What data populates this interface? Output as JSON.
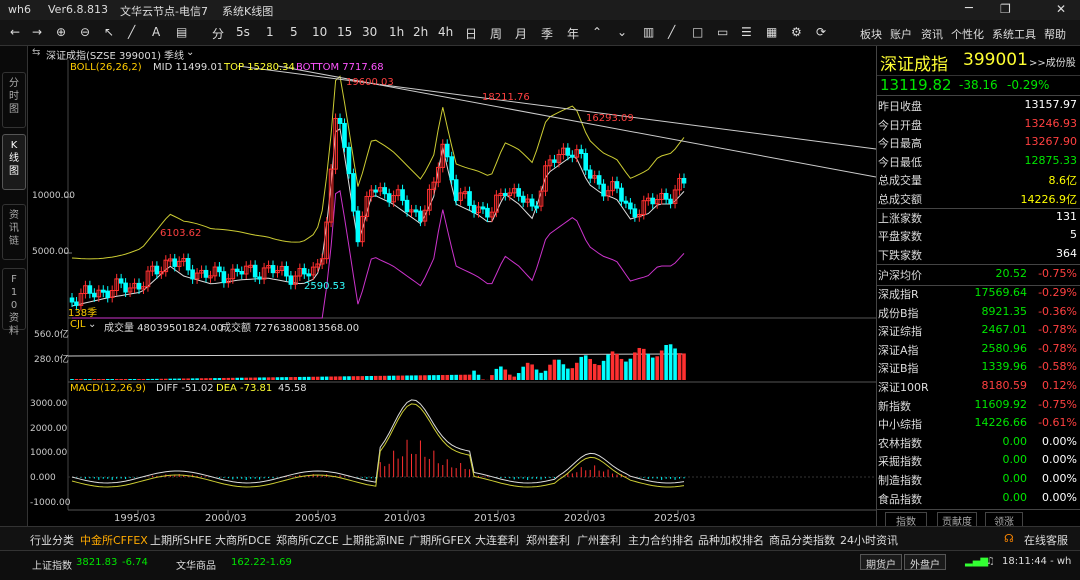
{
  "titlebar": {
    "app": "wh6",
    "version": "Ver6.8.813",
    "server": "文华云节点-电信7",
    "mode": "系统K线图"
  },
  "toolbar": {
    "periods": [
      "分",
      "5s",
      "1",
      "5",
      "10",
      "15",
      "30",
      "1h",
      "2h",
      "4h",
      "日",
      "周",
      "月",
      "季",
      "年"
    ],
    "right_menu": [
      "板块",
      "账户",
      "资讯",
      "个性化",
      "系统工具",
      "帮助"
    ]
  },
  "chart": {
    "instrument": "深证成指(SZSE 399001)",
    "period": "季线",
    "boll": {
      "name": "BOLL(26,26,2)",
      "mid": "MID 11499.01",
      "top": "TOP 15280.34",
      "bottom": "BOTTOM 7717.68"
    },
    "price_labels": [
      "10000.00",
      "5000.00"
    ],
    "annotations": [
      "19600.03",
      "18211.76",
      "16293.09",
      "6103.62",
      "2590.53",
      "138季"
    ],
    "vol": {
      "name": "CJL",
      "volume": "成交量 48039501824.00",
      "amount": "成交额 72763800813568.00",
      "labels": [
        "560.0亿",
        "280.0亿"
      ]
    },
    "macd": {
      "name": "MACD(12,26,9)",
      "diff": "DIFF -51.02",
      "dea": "DEA -73.81",
      "val": "45.58",
      "labels": [
        "3000.00",
        "2000.00",
        "1000.00",
        "0.000",
        "-1000.00"
      ]
    },
    "xlabels": [
      "1995/03",
      "2000/03",
      "2005/03",
      "2010/03",
      "2015/03",
      "2020/03",
      "2025/03"
    ]
  },
  "quote": {
    "name": "深证成指",
    "code": "399001",
    "link": ">>成份股",
    "price": "13119.82",
    "change": "-38.16",
    "pct": "-0.29%",
    "rows": [
      {
        "label": "昨日收盘",
        "value": "13157.97",
        "color": "white"
      },
      {
        "label": "今日开盘",
        "value": "13246.93",
        "color": "red"
      },
      {
        "label": "今日最高",
        "value": "13267.90",
        "color": "red"
      },
      {
        "label": "今日最低",
        "value": "12875.33",
        "color": "green"
      },
      {
        "label": "总成交量",
        "value": "8.6亿",
        "color": "yellow"
      },
      {
        "label": "总成交额",
        "value": "14226.9亿",
        "color": "yellow"
      },
      {
        "label": "上涨家数",
        "value": "131",
        "color": "white"
      },
      {
        "label": "平盘家数",
        "value": "5",
        "color": "white"
      },
      {
        "label": "下跌家数",
        "value": "364",
        "color": "white"
      }
    ],
    "indices": [
      {
        "label": "沪深均价",
        "value": "20.52",
        "pct": "-0.75%",
        "vc": "green",
        "pc": "red"
      },
      {
        "label": "深成指R",
        "value": "17569.64",
        "pct": "-0.29%",
        "vc": "green",
        "pc": "red"
      },
      {
        "label": "成份B指",
        "value": "8921.35",
        "pct": "-0.36%",
        "vc": "green",
        "pc": "red"
      },
      {
        "label": "深证综指",
        "value": "2467.01",
        "pct": "-0.78%",
        "vc": "green",
        "pc": "red"
      },
      {
        "label": "深证A指",
        "value": "2580.96",
        "pct": "-0.78%",
        "vc": "green",
        "pc": "red"
      },
      {
        "label": "深证B指",
        "value": "1339.96",
        "pct": "-0.58%",
        "vc": "green",
        "pc": "red"
      },
      {
        "label": "深证100R",
        "value": "8180.59",
        "pct": "0.12%",
        "vc": "red",
        "pc": "red"
      },
      {
        "label": "新指数",
        "value": "11609.92",
        "pct": "-0.75%",
        "vc": "green",
        "pc": "red"
      },
      {
        "label": "中小综指",
        "value": "14226.66",
        "pct": "-0.61%",
        "vc": "green",
        "pc": "red"
      },
      {
        "label": "农林指数",
        "value": "0.00",
        "pct": "0.00%",
        "vc": "green",
        "pc": "white"
      },
      {
        "label": "采掘指数",
        "value": "0.00",
        "pct": "0.00%",
        "vc": "green",
        "pc": "white"
      },
      {
        "label": "制造指数",
        "value": "0.00",
        "pct": "0.00%",
        "vc": "green",
        "pc": "white"
      },
      {
        "label": "食品指数",
        "value": "0.00",
        "pct": "0.00%",
        "vc": "green",
        "pc": "white"
      }
    ],
    "tabs": [
      "指数",
      "贡献度",
      "领涨"
    ]
  },
  "sidetabs": [
    "分时图",
    "K线图",
    "资讯链",
    "F10资料"
  ],
  "bottom_tabs": [
    "行业分类",
    "中金所CFFEX",
    "上期所SHFE",
    "大商所DCE",
    "郑商所CZCE",
    "上期能源INE",
    "广期所GFEX",
    "大连套利",
    "郑州套利",
    "广州套利",
    "主力合约排名",
    "品种加权排名",
    "商品分类指数",
    "24小时资讯"
  ],
  "service": "在线客服",
  "status": {
    "idx1_name": "上证指数",
    "idx1_val": "3821.83",
    "idx1_chg": "-6.74",
    "idx2_name": "文华商品",
    "idx2_val": "162.22",
    "idx2_chg": "-1.69",
    "btn1": "期货户",
    "btn2": "外盘户",
    "time": "18:11:44 - wh"
  }
}
